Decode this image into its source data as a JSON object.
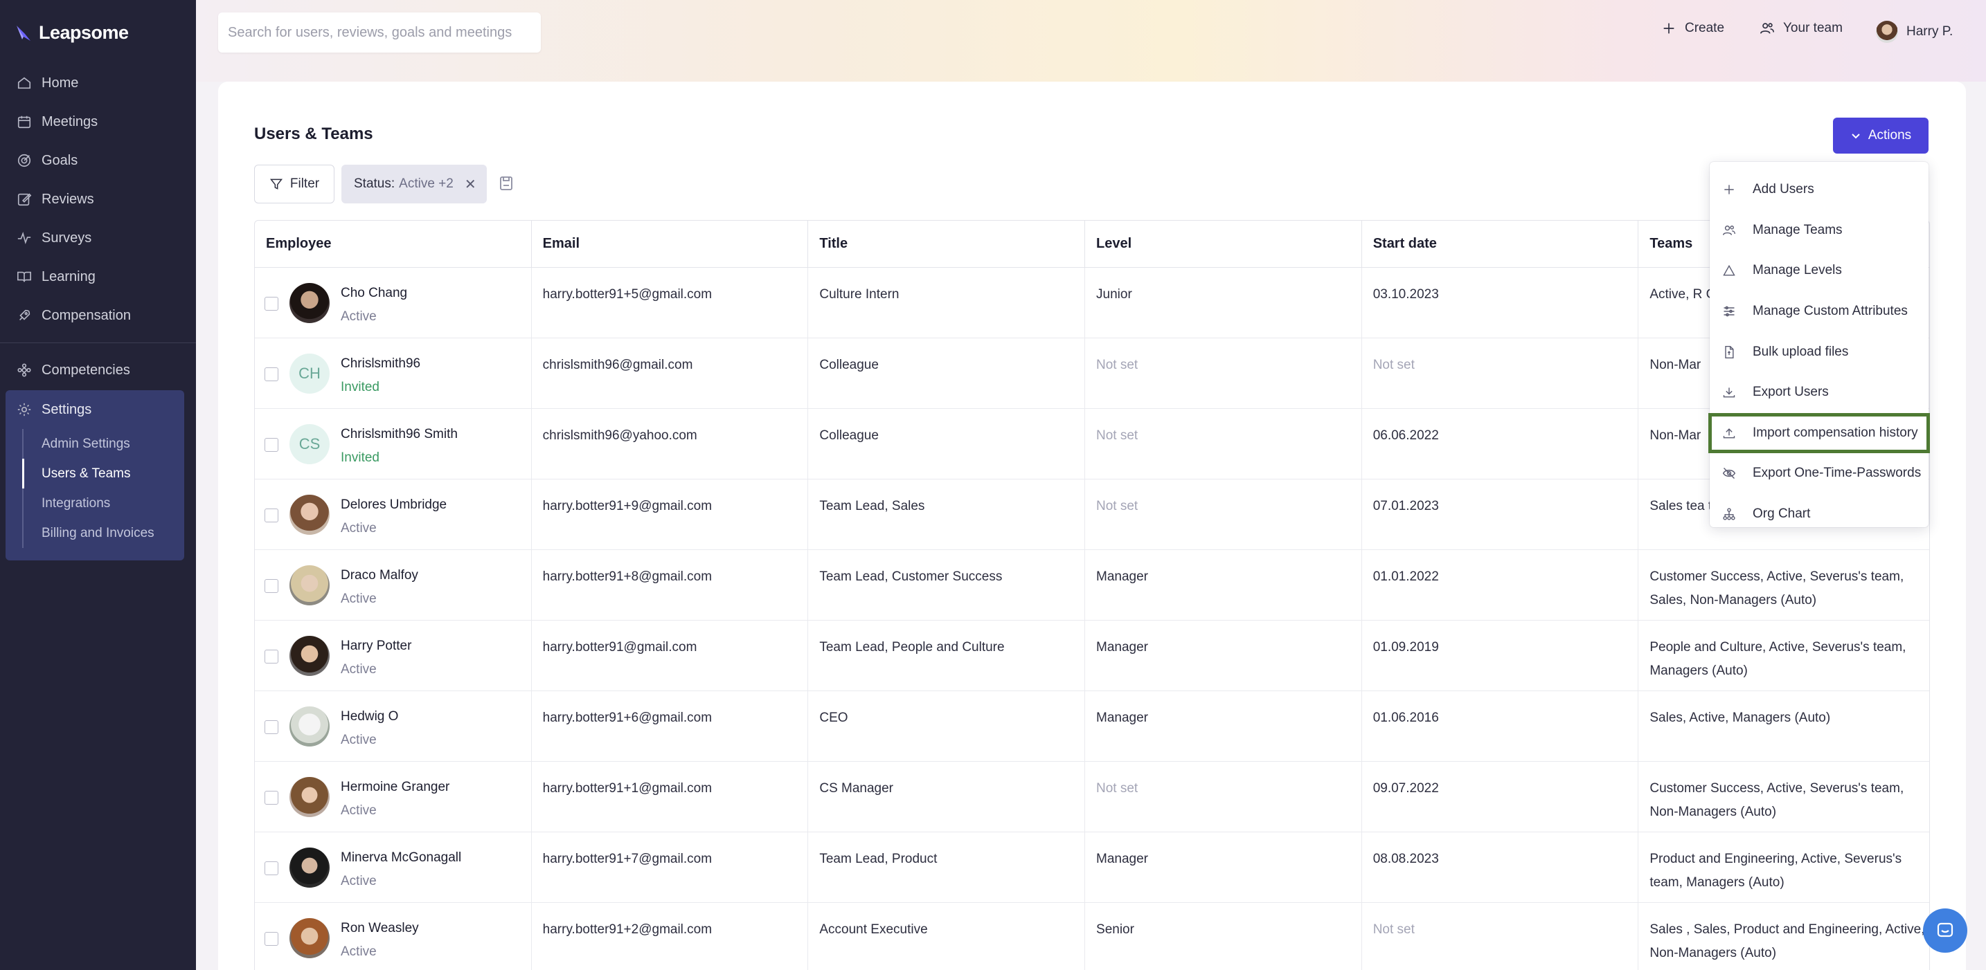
{
  "app": {
    "name": "Leapsome"
  },
  "search": {
    "placeholder": "Search for users, reviews, goals and meetings"
  },
  "topbar": {
    "create_label": "Create",
    "team_label": "Your team",
    "user_label": "Harry P."
  },
  "sidebar": {
    "items": [
      {
        "label": "Home",
        "icon": "home-icon"
      },
      {
        "label": "Meetings",
        "icon": "calendar-icon"
      },
      {
        "label": "Goals",
        "icon": "target-icon"
      },
      {
        "label": "Reviews",
        "icon": "edit-icon"
      },
      {
        "label": "Surveys",
        "icon": "pulse-icon"
      },
      {
        "label": "Learning",
        "icon": "book-icon"
      },
      {
        "label": "Compensation",
        "icon": "rocket-icon"
      }
    ],
    "competencies": "Competencies",
    "settings": "Settings",
    "settings_sub": [
      "Admin Settings",
      "Users & Teams",
      "Integrations",
      "Billing and Invoices"
    ]
  },
  "page": {
    "title": "Users & Teams",
    "actions_label": "Actions",
    "filter_label": "Filter",
    "chip_key": "Status:",
    "chip_value": "Active +2"
  },
  "table": {
    "headers": [
      "Employee",
      "Email",
      "Title",
      "Level",
      "Start date",
      "Teams"
    ],
    "rows": [
      {
        "name": "Cho Chang",
        "status": "Active",
        "email": "harry.botter91+5@gmail.com",
        "title": "Culture Intern",
        "level": "Junior",
        "start": "03.10.2023",
        "teams": "Active, R Culture, I"
      },
      {
        "name": "Chrislsmith96",
        "status": "Invited",
        "initials": "CH",
        "email": "chrislsmith96@gmail.com",
        "title": "Colleague",
        "level": "Not set",
        "start": "Not set",
        "teams": "Non-Mar"
      },
      {
        "name": "Chrislsmith96 Smith",
        "status": "Invited",
        "initials": "CS",
        "email": "chrislsmith96@yahoo.com",
        "title": "Colleague",
        "level": "Not set",
        "start": "06.06.2022",
        "teams": "Non-Mar"
      },
      {
        "name": "Delores Umbridge",
        "status": "Active",
        "email": "harry.botter91+9@gmail.com",
        "title": "Team Lead, Sales",
        "level": "Not set",
        "start": "07.01.2023",
        "teams": "Sales tea team, Managers (Auto)"
      },
      {
        "name": "Draco Malfoy",
        "status": "Active",
        "email": "harry.botter91+8@gmail.com",
        "title": "Team Lead, Customer Success",
        "level": "Manager",
        "start": "01.01.2022",
        "teams": "Customer Success, Active, Severus's team, Sales, Non-Managers (Auto)"
      },
      {
        "name": "Harry Potter",
        "status": "Active",
        "email": "harry.botter91@gmail.com",
        "title": "Team Lead, People and Culture",
        "level": "Manager",
        "start": "01.09.2019",
        "teams": "People and Culture, Active, Severus's team, Managers (Auto)"
      },
      {
        "name": "Hedwig O",
        "status": "Active",
        "email": "harry.botter91+6@gmail.com",
        "title": "CEO",
        "level": "Manager",
        "start": "01.06.2016",
        "teams": "Sales, Active, Managers (Auto)"
      },
      {
        "name": "Hermoine Granger",
        "status": "Active",
        "email": "harry.botter91+1@gmail.com",
        "title": "CS Manager",
        "level": "Not set",
        "start": "09.07.2022",
        "teams": "Customer Success, Active, Severus's team, Non-Managers (Auto)"
      },
      {
        "name": "Minerva McGonagall",
        "status": "Active",
        "email": "harry.botter91+7@gmail.com",
        "title": "Team Lead, Product",
        "level": "Manager",
        "start": "08.08.2023",
        "teams": "Product and Engineering, Active, Severus's team, Managers (Auto)"
      },
      {
        "name": "Ron Weasley",
        "status": "Active",
        "email": "harry.botter91+2@gmail.com",
        "title": "Account Executive",
        "level": "Senior",
        "start": "Not set",
        "teams": "Sales , Sales, Product and Engineering, Active, Non-Managers (Auto)"
      }
    ]
  },
  "dropdown": {
    "items": [
      "Add Users",
      "Manage Teams",
      "Manage Levels",
      "Manage Custom Attributes",
      "Bulk upload files",
      "Export Users",
      "Import compensation history",
      "Export One-Time-Passwords",
      "Org Chart"
    ],
    "highlighted_index": 6
  },
  "colors": {
    "accent": "#4b43d9",
    "sidebar": "#232337",
    "highlight_border": "#4e7a33",
    "invited": "#3a9a62"
  }
}
